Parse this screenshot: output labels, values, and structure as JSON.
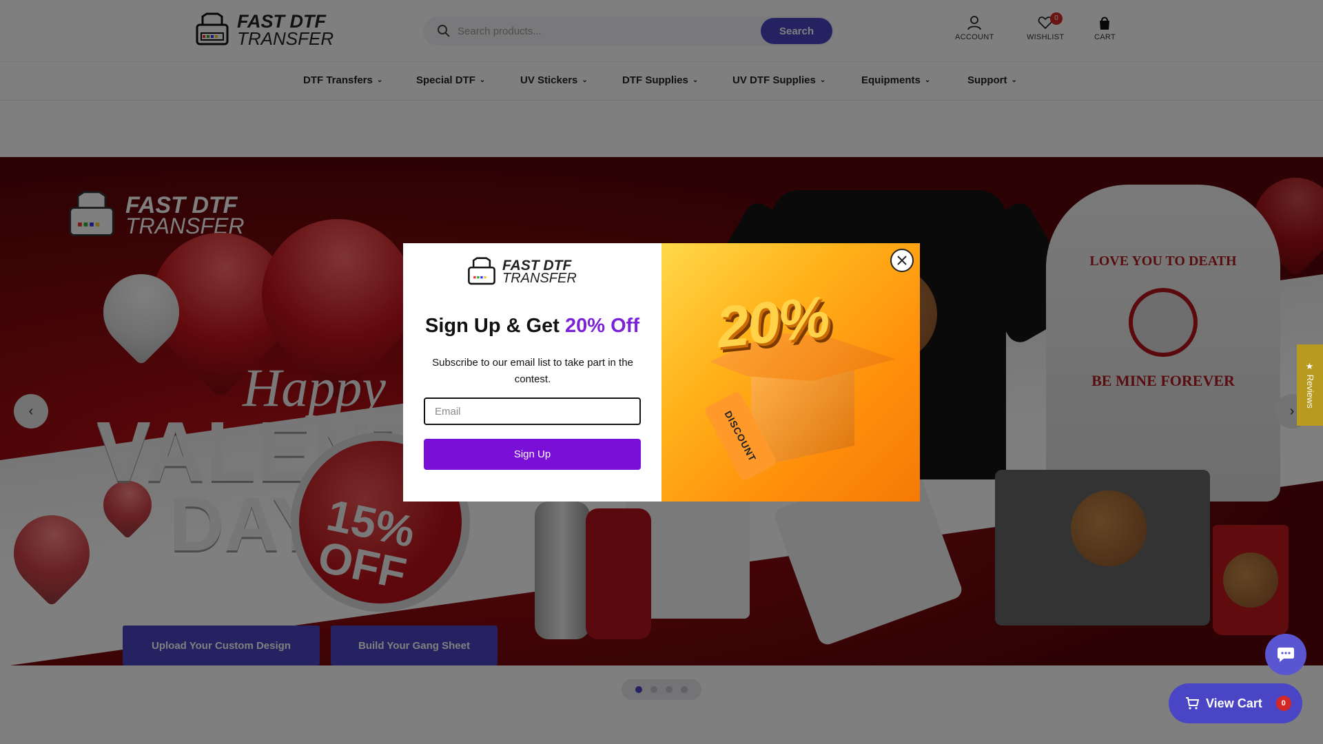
{
  "brand": {
    "line1": "FAST DTF",
    "line2": "TRANSFER"
  },
  "search": {
    "placeholder": "Search products...",
    "button": "Search"
  },
  "header_icons": {
    "account": "ACCOUNT",
    "wishlist": "WISHLIST",
    "wishlist_count": "0",
    "cart": "CART"
  },
  "nav": [
    {
      "label": "DTF Transfers"
    },
    {
      "label": "Special DTF"
    },
    {
      "label": "UV Stickers"
    },
    {
      "label": "DTF Supplies"
    },
    {
      "label": "UV DTF Supplies"
    },
    {
      "label": "Equipments"
    },
    {
      "label": "Support"
    }
  ],
  "banner": {
    "logo_line1": "FAST DTF",
    "logo_line2": "TRANSFER",
    "happy": "Happy",
    "valentine": "VALENTINE",
    "day": "DAY",
    "off_pct": "15%",
    "off": "OFF",
    "hoodie_top": "LOVE YOU TO DEATH",
    "hoodie_bottom": "BE MINE FOREVER",
    "cta_upload": "Upload Your Custom Design",
    "cta_gang": "Build Your Gang Sheet",
    "slides": 4,
    "active_slide": 1
  },
  "reviews_tab": "★ Reviews",
  "popup": {
    "headline_main": "Sign Up & Get ",
    "headline_accent": "20% Off",
    "subtext": "Subscribe to our email list to take part in the contest.",
    "email_placeholder": "Email",
    "signup_button": "Sign Up",
    "promo_percent": "20%",
    "tag_text": "DISCOUNT"
  },
  "view_cart": {
    "label": "View Cart",
    "count": "0"
  },
  "colors": {
    "primary": "#4a45c4",
    "popup_purple": "#7a0fd8",
    "badge_red": "#d42828"
  }
}
